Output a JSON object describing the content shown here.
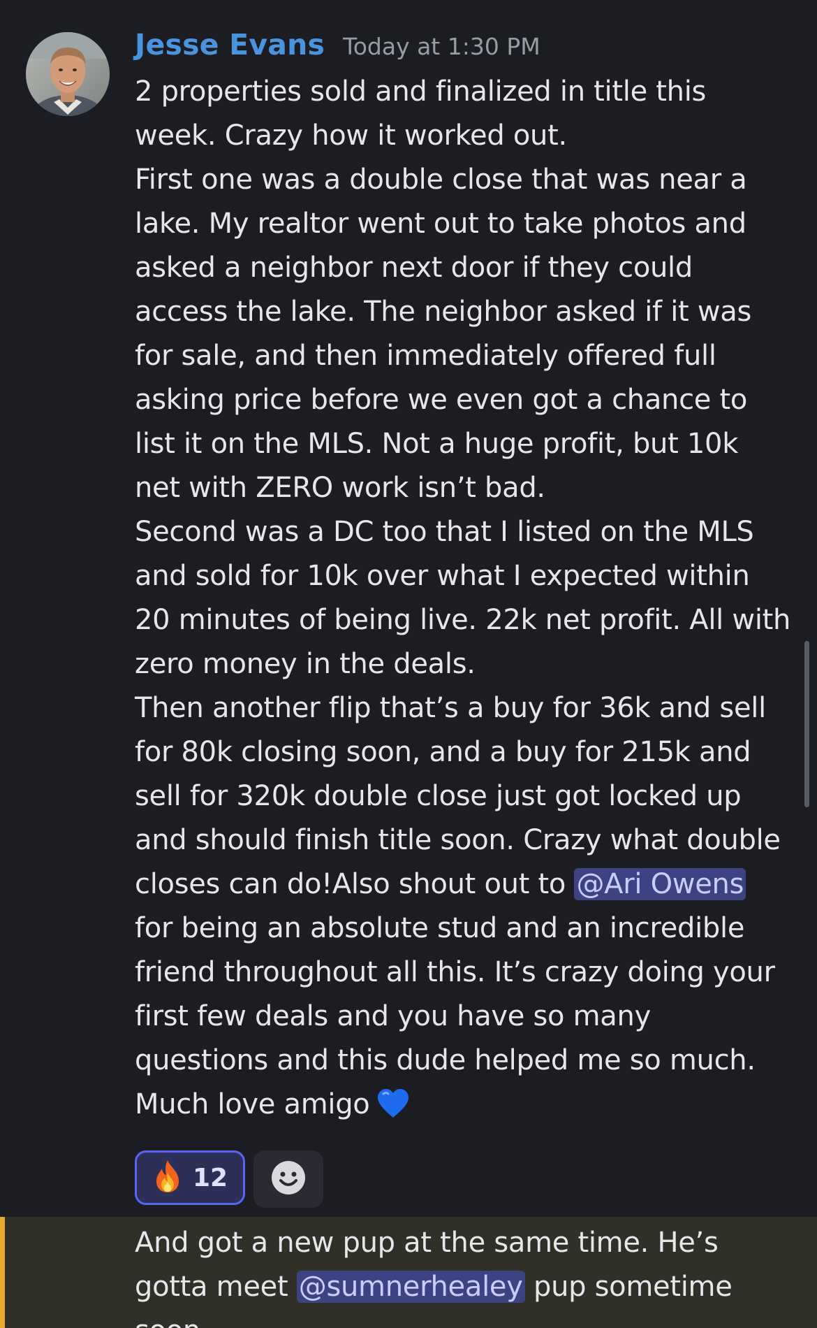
{
  "message": {
    "author": "Jesse Evans",
    "timestamp": "Today at 1:30 PM",
    "paragraphs": [
      "2 properties sold and finalized in title this week. Crazy how it worked out.",
      "First one was a double close that was near a lake. My realtor went out to take photos and asked a neighbor next door if they could access the lake. The neighbor asked if it was for sale, and then immediately offered full asking price before we even got a chance to list it on the MLS. Not a huge profit, but 10k net with ZERO work isn’t bad.",
      "Second was a DC too that I listed on the MLS and sold for 10k over what I expected within 20 minutes of being live. 22k net profit. All with zero money in the deals."
    ],
    "last_paragraph": {
      "before_mention": "Then another flip that’s a buy for 36k and sell for 80k closing soon, and a buy for 215k and sell for 320k double close just got locked up and should finish title soon. Crazy what double closes can do!Also shout out to ",
      "mention": "@Ari Owens",
      "after_mention": " for being an absolute stud and an incredible friend throughout all this. It’s crazy doing your first few deals and you have so many questions and this dude helped me so much. Much love amigo"
    },
    "emoji_icon": "blue-heart-icon"
  },
  "reactions": [
    {
      "icon": "fire-icon",
      "count": "12"
    }
  ],
  "add_reaction_icon": "smiley-icon",
  "followup": {
    "before_mention": "And got a new pup at the same time. He’s gotta meet ",
    "mention": "@sumnerhealey",
    "after_mention": " pup sometime soon"
  },
  "colors": {
    "background": "#1c1d22",
    "username": "#4a93dd",
    "mention_bg": "#3d4283",
    "reaction_border": "#5865f2",
    "highlight_bar": "#e8a82d"
  }
}
